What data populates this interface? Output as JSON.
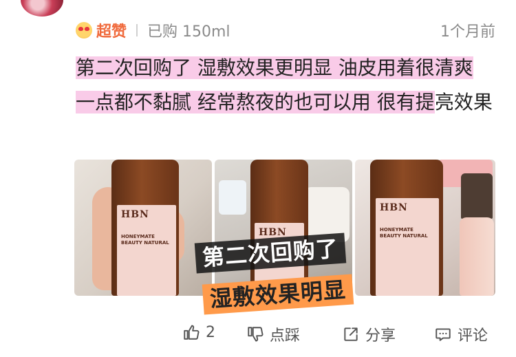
{
  "review": {
    "rating_label": "超赞",
    "purchase_info": "已购 150ml",
    "time_ago": "1个月前",
    "text_highlighted": "第二次回购了 湿敷效果更明显 油皮用着很清爽 一点都不黏腻 经常熬夜的也可以用 很有提",
    "text_plain": "亮效果"
  },
  "photos": {
    "bottle_brand": "HBN",
    "label_line1": "HONEYMATE",
    "label_line2": "BEAUTY NATURAL",
    "overlay_line1": "第二次回购了",
    "overlay_line2": "湿敷效果明显"
  },
  "actions": {
    "like_count": "2",
    "dislike_label": "点踩",
    "share_label": "分享",
    "comment_label": "评论"
  },
  "colors": {
    "highlight": "#f9cbe8",
    "rating": "#f06a3c",
    "overlay_bg": "#ff9a4a"
  },
  "icons": [
    "heart-eyes-emoji-icon",
    "thumbs-up-icon",
    "thumbs-down-icon",
    "share-icon",
    "comment-icon"
  ]
}
